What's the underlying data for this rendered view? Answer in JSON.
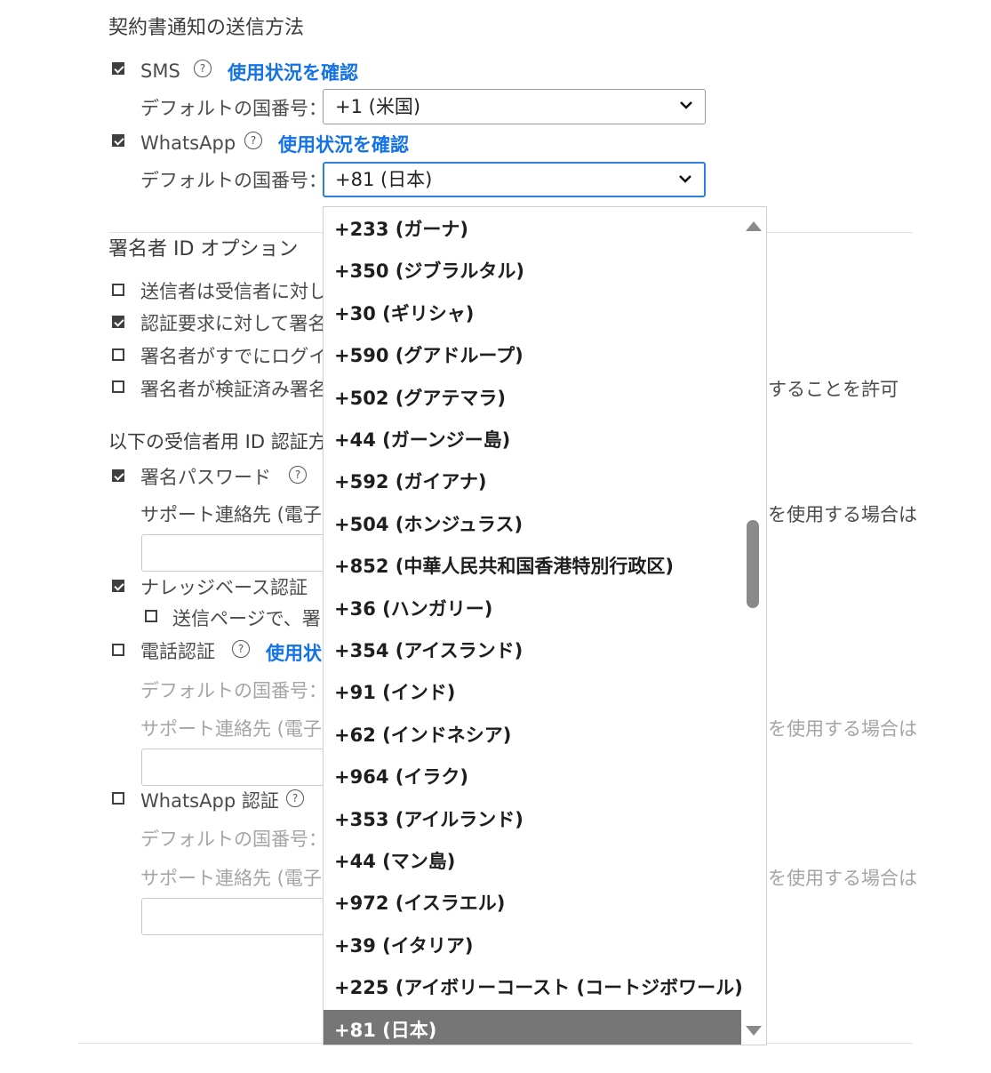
{
  "notification": {
    "heading": "契約書通知の送信方法",
    "sms": {
      "label": "SMS",
      "checked": true,
      "link": "使用状況を確認",
      "country_label": "デフォルトの国番号：",
      "country_value": "+1 (米国)"
    },
    "whatsapp": {
      "label": "WhatsApp",
      "checked": true,
      "link": "使用状況を確認",
      "country_label": "デフォルトの国番号：",
      "country_value": "+81 (日本)"
    }
  },
  "signer_id": {
    "heading": "署名者 ID オプション",
    "options": [
      {
        "label": "送信者は受信者に対し",
        "checked": false
      },
      {
        "label": "認証要求に対して署名",
        "checked": true
      },
      {
        "label": "署名者がすでにログイ",
        "checked": false
      },
      {
        "label": "署名者が検証済み署名",
        "checked": false,
        "tail": "することを許可"
      }
    ]
  },
  "recipient_auth": {
    "heading": "以下の受信者用 ID 認証方",
    "password": {
      "label": "署名パスワード",
      "checked": true,
      "support_label": "サポート連絡先 (電子",
      "support_tail": "を使用する場合は"
    },
    "kba": {
      "label": "ナレッジベース認証",
      "checked": true,
      "sub_label": "送信ページで、署",
      "sub_checked": false
    },
    "phone": {
      "label": "電話認証",
      "checked": false,
      "link": "使用状",
      "country_label": "デフォルトの国番号：",
      "support_label": "サポート連絡先 (電子",
      "support_tail": "を使用する場合は"
    },
    "whatsapp_auth": {
      "label": "WhatsApp 認証",
      "checked": false,
      "country_label": "デフォルトの国番号：",
      "support_label": "サポート連絡先 (電子",
      "support_tail": "を使用する場合は"
    }
  },
  "dropdown": {
    "options": [
      "+233 (ガーナ)",
      "+350 (ジブラルタル)",
      "+30 (ギリシャ)",
      "+590 (グアドループ)",
      "+502 (グアテマラ)",
      "+44 (ガーンジー島)",
      "+592 (ガイアナ)",
      "+504 (ホンジュラス)",
      "+852 (中華人民共和国香港特別行政区)",
      "+36 (ハンガリー)",
      "+354 (アイスランド)",
      "+91 (インド)",
      "+62 (インドネシア)",
      "+964 (イラク)",
      "+353 (アイルランド)",
      "+44 (マン島)",
      "+972 (イスラエル)",
      "+39 (イタリア)",
      "+225 (アイボリーコースト (コートジボワール))",
      "+81 (日本)"
    ],
    "selected": "+81 (日本)"
  },
  "colors": {
    "link": "#1473e6",
    "focus_border": "#2e7ee0",
    "selected_bg": "#767676"
  }
}
